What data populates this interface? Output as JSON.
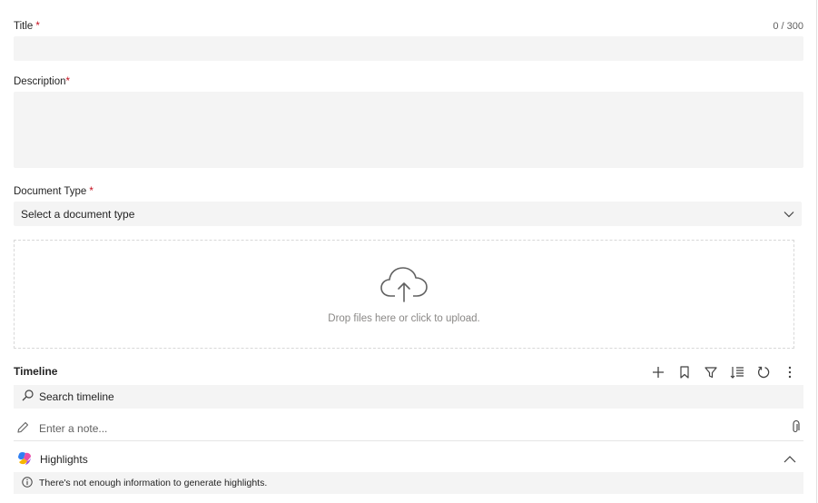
{
  "title_field": {
    "label": "Title",
    "required_mark": "*",
    "counter": "0 / 300",
    "value": ""
  },
  "description_field": {
    "label": "Description",
    "required_mark": "*",
    "value": ""
  },
  "document_type": {
    "label": "Document Type",
    "required_mark": "*",
    "selected": "Select a document type"
  },
  "upload": {
    "icon": "cloud-upload-icon",
    "text": "Drop files here or click to upload."
  },
  "timeline": {
    "title": "Timeline",
    "toolbar": [
      "add-icon",
      "bookmark-icon",
      "filter-icon",
      "sort-icon",
      "refresh-icon",
      "more-icon"
    ],
    "search_label": "Search timeline",
    "note_placeholder": "Enter a note...",
    "highlights_label": "Highlights",
    "highlights_message": "There's not enough information to generate highlights."
  },
  "colors": {
    "required": "#c50f1f",
    "field_bg": "#f4f4f4",
    "muted_text": "#8a8886"
  }
}
